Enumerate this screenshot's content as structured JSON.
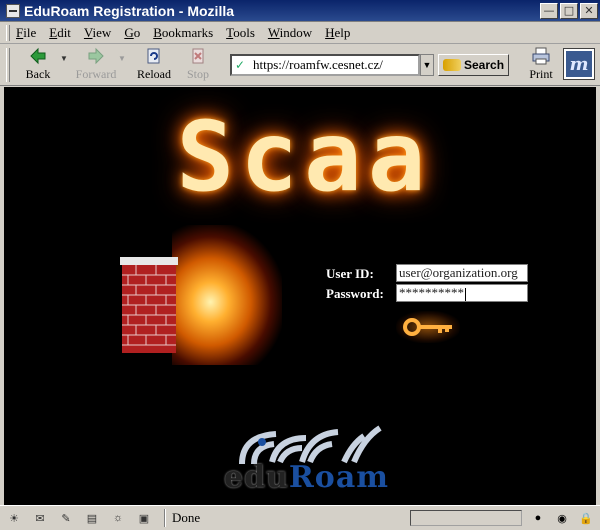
{
  "window": {
    "title": "EduRoam Registration - Mozilla"
  },
  "menu": [
    "File",
    "Edit",
    "View",
    "Go",
    "Bookmarks",
    "Tools",
    "Window",
    "Help"
  ],
  "nav": {
    "back": "Back",
    "forward": "Forward",
    "reload": "Reload",
    "stop": "Stop",
    "url": "https://roamfw.cesnet.cz/",
    "search": "Search",
    "print": "Print"
  },
  "page": {
    "logo_text": "Scaa",
    "userid_label": "User ID:",
    "password_label": "Password:",
    "userid_value": "user@organization.org",
    "password_value": "**********",
    "eduroam_edu": "edu",
    "eduroam_roam": "Roam"
  },
  "status": {
    "text": "Done"
  },
  "colors": {
    "page_bg": "#000000",
    "chrome_bg": "#d4d0c8",
    "titlebar": "#0a246a",
    "roam_blue": "#1a4fa0"
  }
}
